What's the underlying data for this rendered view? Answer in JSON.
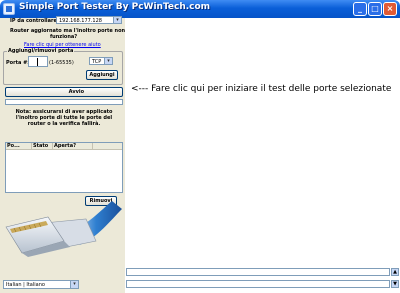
{
  "window": {
    "title": "Simple Port Tester By PcWinTech.com"
  },
  "controls": {
    "minimize": "_",
    "maximize": "□",
    "close": "×"
  },
  "ip": {
    "label": "IP da controllare:",
    "value": "192.168.177.128"
  },
  "router": {
    "question_line1": "Router aggiornato ma l'inoltro porte non",
    "question_line2": "funziona?",
    "help_link": "Fare clic qui per ottenere aiuto"
  },
  "add_remove": {
    "title": "Aggiungi/rimuovi porta",
    "port_label": "Porta #:",
    "range_label": "(1-65535)",
    "protocol": "TCP",
    "add_button": "Aggiungi"
  },
  "start_button": "Avvio",
  "hint": "<--- Fare clic qui per iniziare il test delle porte selezionate",
  "note": {
    "line1": "Nota: assicurarsi di aver applicato",
    "line2": "l'inoltro porte di tutte le porte del",
    "line3": "router o la verifica fallirà."
  },
  "list": {
    "columns": [
      "Po...",
      "Stato",
      "Aperta?"
    ]
  },
  "remove_button": "Rimuovi",
  "language": {
    "value": "Italian | Italiano"
  },
  "colors": {
    "accent": "#0553c8",
    "panel": "#ece9d8",
    "hint_text": "#000000"
  }
}
